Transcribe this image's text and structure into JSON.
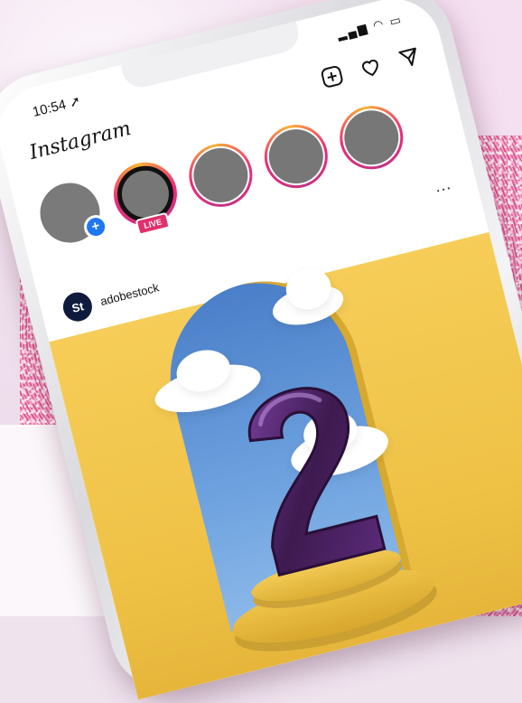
{
  "status_bar": {
    "time": "10:54",
    "location_icon": "location-arrow-icon",
    "signal_icons": "▂▄▆ ◠ ▭"
  },
  "app": {
    "logo_text": "Instagram"
  },
  "top_icons": [
    "add-post-icon",
    "heart-icon",
    "direct-message-icon"
  ],
  "stories": [
    {
      "type": "own",
      "add_symbol": "+"
    },
    {
      "type": "live",
      "badge": "LIVE"
    },
    {
      "type": "ring"
    },
    {
      "type": "ring"
    },
    {
      "type": "ring"
    }
  ],
  "post": {
    "more_symbol": "...",
    "avatar_text": "St",
    "username": "adobestock",
    "image_subject": "2"
  },
  "colors": {
    "accent_blue": "#1f77f2",
    "live_pink": "#e1306c",
    "balloon_purple": "#3d1a4f"
  }
}
